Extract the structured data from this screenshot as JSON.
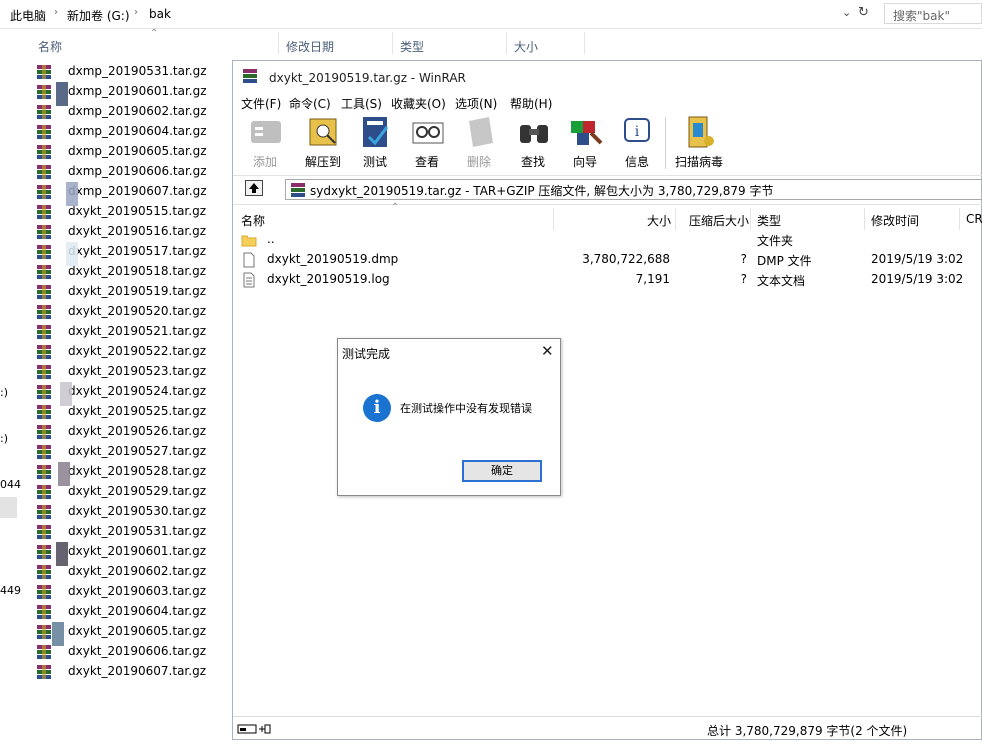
{
  "explorer": {
    "breadcrumb": [
      "此电脑",
      "新加卷 (G:)",
      "bak"
    ],
    "search_placeholder": "搜索\"bak\"",
    "columns": {
      "name": "名称",
      "modified": "修改日期",
      "type": "类型",
      "size": "大小"
    },
    "files": [
      "dxmp_20190531.tar.gz",
      "dxmp_20190601.tar.gz",
      "dxmp_20190602.tar.gz",
      "dxmp_20190604.tar.gz",
      "dxmp_20190605.tar.gz",
      "dxmp_20190606.tar.gz",
      "dxmp_20190607.tar.gz",
      "dxykt_20190515.tar.gz",
      "dxykt_20190516.tar.gz",
      "dxykt_20190517.tar.gz",
      "dxykt_20190518.tar.gz",
      "dxykt_20190519.tar.gz",
      "dxykt_20190520.tar.gz",
      "dxykt_20190521.tar.gz",
      "dxykt_20190522.tar.gz",
      "dxykt_20190523.tar.gz",
      "dxykt_20190524.tar.gz",
      "dxykt_20190525.tar.gz",
      "dxykt_20190526.tar.gz",
      "dxykt_20190527.tar.gz",
      "dxykt_20190528.tar.gz",
      "dxykt_20190529.tar.gz",
      "dxykt_20190530.tar.gz",
      "dxykt_20190531.tar.gz",
      "dxykt_20190601.tar.gz",
      "dxykt_20190602.tar.gz",
      "dxykt_20190603.tar.gz",
      "dxykt_20190604.tar.gz",
      "dxykt_20190605.tar.gz",
      "dxykt_20190606.tar.gz",
      "dxykt_20190607.tar.gz"
    ],
    "side_fragments": [
      ":)",
      ":)",
      "044",
      "449"
    ]
  },
  "winrar": {
    "title": "dxykt_20190519.tar.gz - WinRAR",
    "menu": [
      "文件(F)",
      "命令(C)",
      "工具(S)",
      "收藏夹(O)",
      "选项(N)",
      "帮助(H)"
    ],
    "toolbar": [
      {
        "label": "添加",
        "icon": "add-icon",
        "enabled": false
      },
      {
        "label": "解压到",
        "icon": "extract-icon",
        "enabled": true
      },
      {
        "label": "测试",
        "icon": "test-icon",
        "enabled": true
      },
      {
        "label": "查看",
        "icon": "view-icon",
        "enabled": true
      },
      {
        "label": "删除",
        "icon": "delete-icon",
        "enabled": false
      },
      {
        "label": "查找",
        "icon": "find-icon",
        "enabled": true
      },
      {
        "label": "向导",
        "icon": "wizard-icon",
        "enabled": true
      },
      {
        "label": "信息",
        "icon": "info-icon",
        "enabled": true
      },
      {
        "label": "扫描病毒",
        "icon": "virus-scan-icon",
        "enabled": true
      }
    ],
    "path": "sydxykt_20190519.tar.gz - TAR+GZIP 压缩文件, 解包大小为 3,780,729,879 字节",
    "columns": {
      "name": "名称",
      "size": "大小",
      "packed": "压缩后大小",
      "type": "类型",
      "modified": "修改时间",
      "crc": "CR"
    },
    "rows": [
      {
        "name": "..",
        "size": "",
        "packed": "",
        "type": "文件夹",
        "modified": ""
      },
      {
        "name": "dxykt_20190519.dmp",
        "size": "3,780,722,688",
        "packed": "?",
        "type": "DMP 文件",
        "modified": "2019/5/19 3:02"
      },
      {
        "name": "dxykt_20190519.log",
        "size": "7,191",
        "packed": "?",
        "type": "文本文档",
        "modified": "2019/5/19 3:02"
      }
    ],
    "status_total": "总计 3,780,729,879 字节(2 个文件)"
  },
  "dialog": {
    "title": "测试完成",
    "message": "在测试操作中没有发现错误",
    "ok_label": "确定",
    "close_glyph": "✕",
    "info_glyph": "i"
  },
  "colors": {
    "accent": "#1a73d0",
    "header_text": "#4c607a",
    "disabled_text": "#999999"
  }
}
